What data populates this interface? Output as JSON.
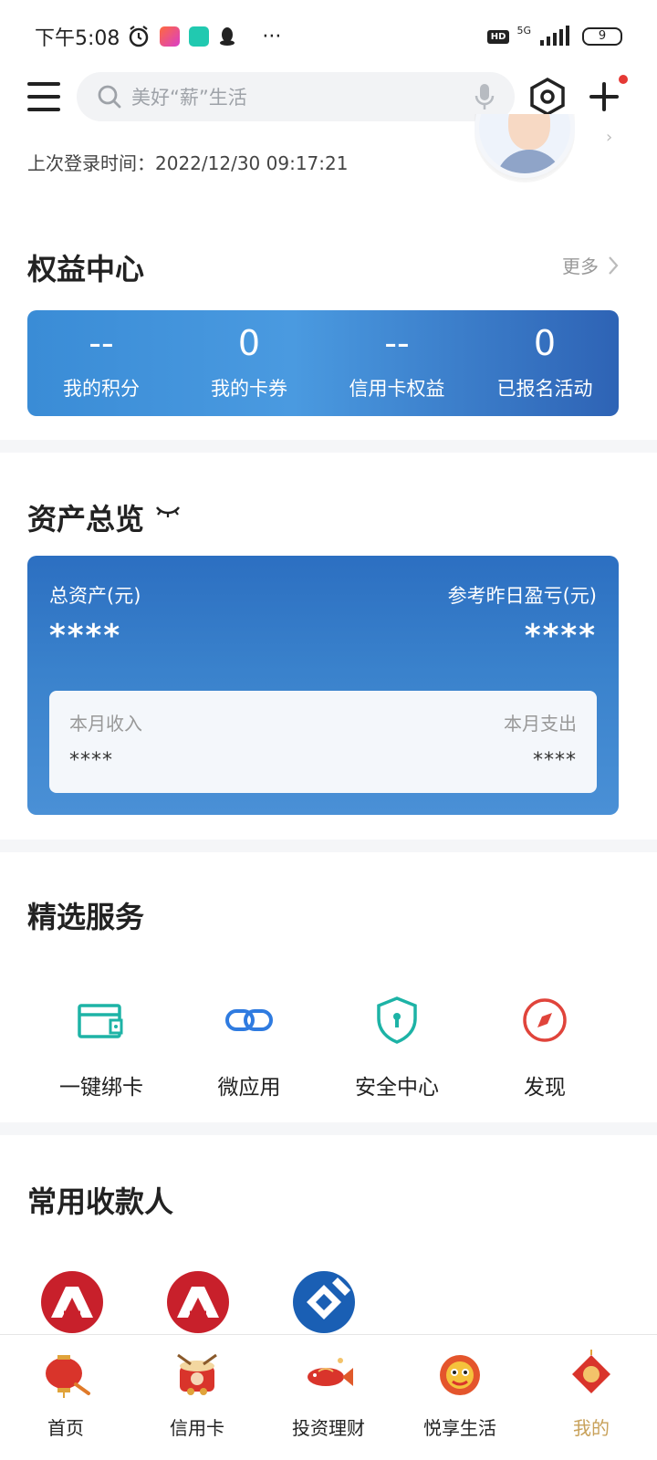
{
  "status_bar": {
    "time": "下午5:08",
    "network": "5G",
    "hd": "HD",
    "battery": "9",
    "more": "···"
  },
  "search": {
    "placeholder": "美好“薪”生活"
  },
  "login": {
    "text": "上次登录时间：2022/12/30 09:17:21"
  },
  "rights_center": {
    "title": "权益中心",
    "more": "更多",
    "items": [
      {
        "value": "--",
        "label": "我的积分"
      },
      {
        "value": "0",
        "label": "我的卡券"
      },
      {
        "value": "--",
        "label": "信用卡权益"
      },
      {
        "value": "0",
        "label": "已报名活动"
      }
    ]
  },
  "assets": {
    "title": "资产总览",
    "total_label": "总资产(元)",
    "total_value": "****",
    "yesterday_label": "参考昨日盈亏(元)",
    "yesterday_value": "****",
    "income_label": "本月收入",
    "income_value": "****",
    "expense_label": "本月支出",
    "expense_value": "****"
  },
  "services": {
    "title": "精选服务",
    "items": [
      {
        "label": "一键绑卡",
        "icon": "card-bind-icon",
        "color": "#1db3a6"
      },
      {
        "label": "微应用",
        "icon": "link-icon",
        "color": "#2f7be0"
      },
      {
        "label": "安全中心",
        "icon": "shield-keyhole-icon",
        "color": "#1db3a6"
      },
      {
        "label": "发现",
        "icon": "compass-icon",
        "color": "#e0443b"
      }
    ]
  },
  "payees": {
    "title": "常用收款人",
    "items": [
      {
        "icon": "cmb-bank-logo-icon",
        "color": "#c8202b"
      },
      {
        "icon": "cmb-bank-logo-icon",
        "color": "#c8202b"
      },
      {
        "icon": "ccb-bank-logo-icon",
        "color": "#1a5fb4"
      }
    ]
  },
  "tabbar": {
    "items": [
      {
        "label": "首页",
        "icon": "lantern-icon",
        "active": false
      },
      {
        "label": "信用卡",
        "icon": "drum-icon",
        "active": false
      },
      {
        "label": "投资理财",
        "icon": "fish-icon",
        "active": false
      },
      {
        "label": "悦享生活",
        "icon": "lion-dance-icon",
        "active": false
      },
      {
        "label": "我的",
        "icon": "fu-ornament-icon",
        "active": true
      }
    ]
  },
  "colors": {
    "accent_blue": "#2c6fc1",
    "active_tab": "#c8a15a",
    "notification": "#e53935"
  }
}
